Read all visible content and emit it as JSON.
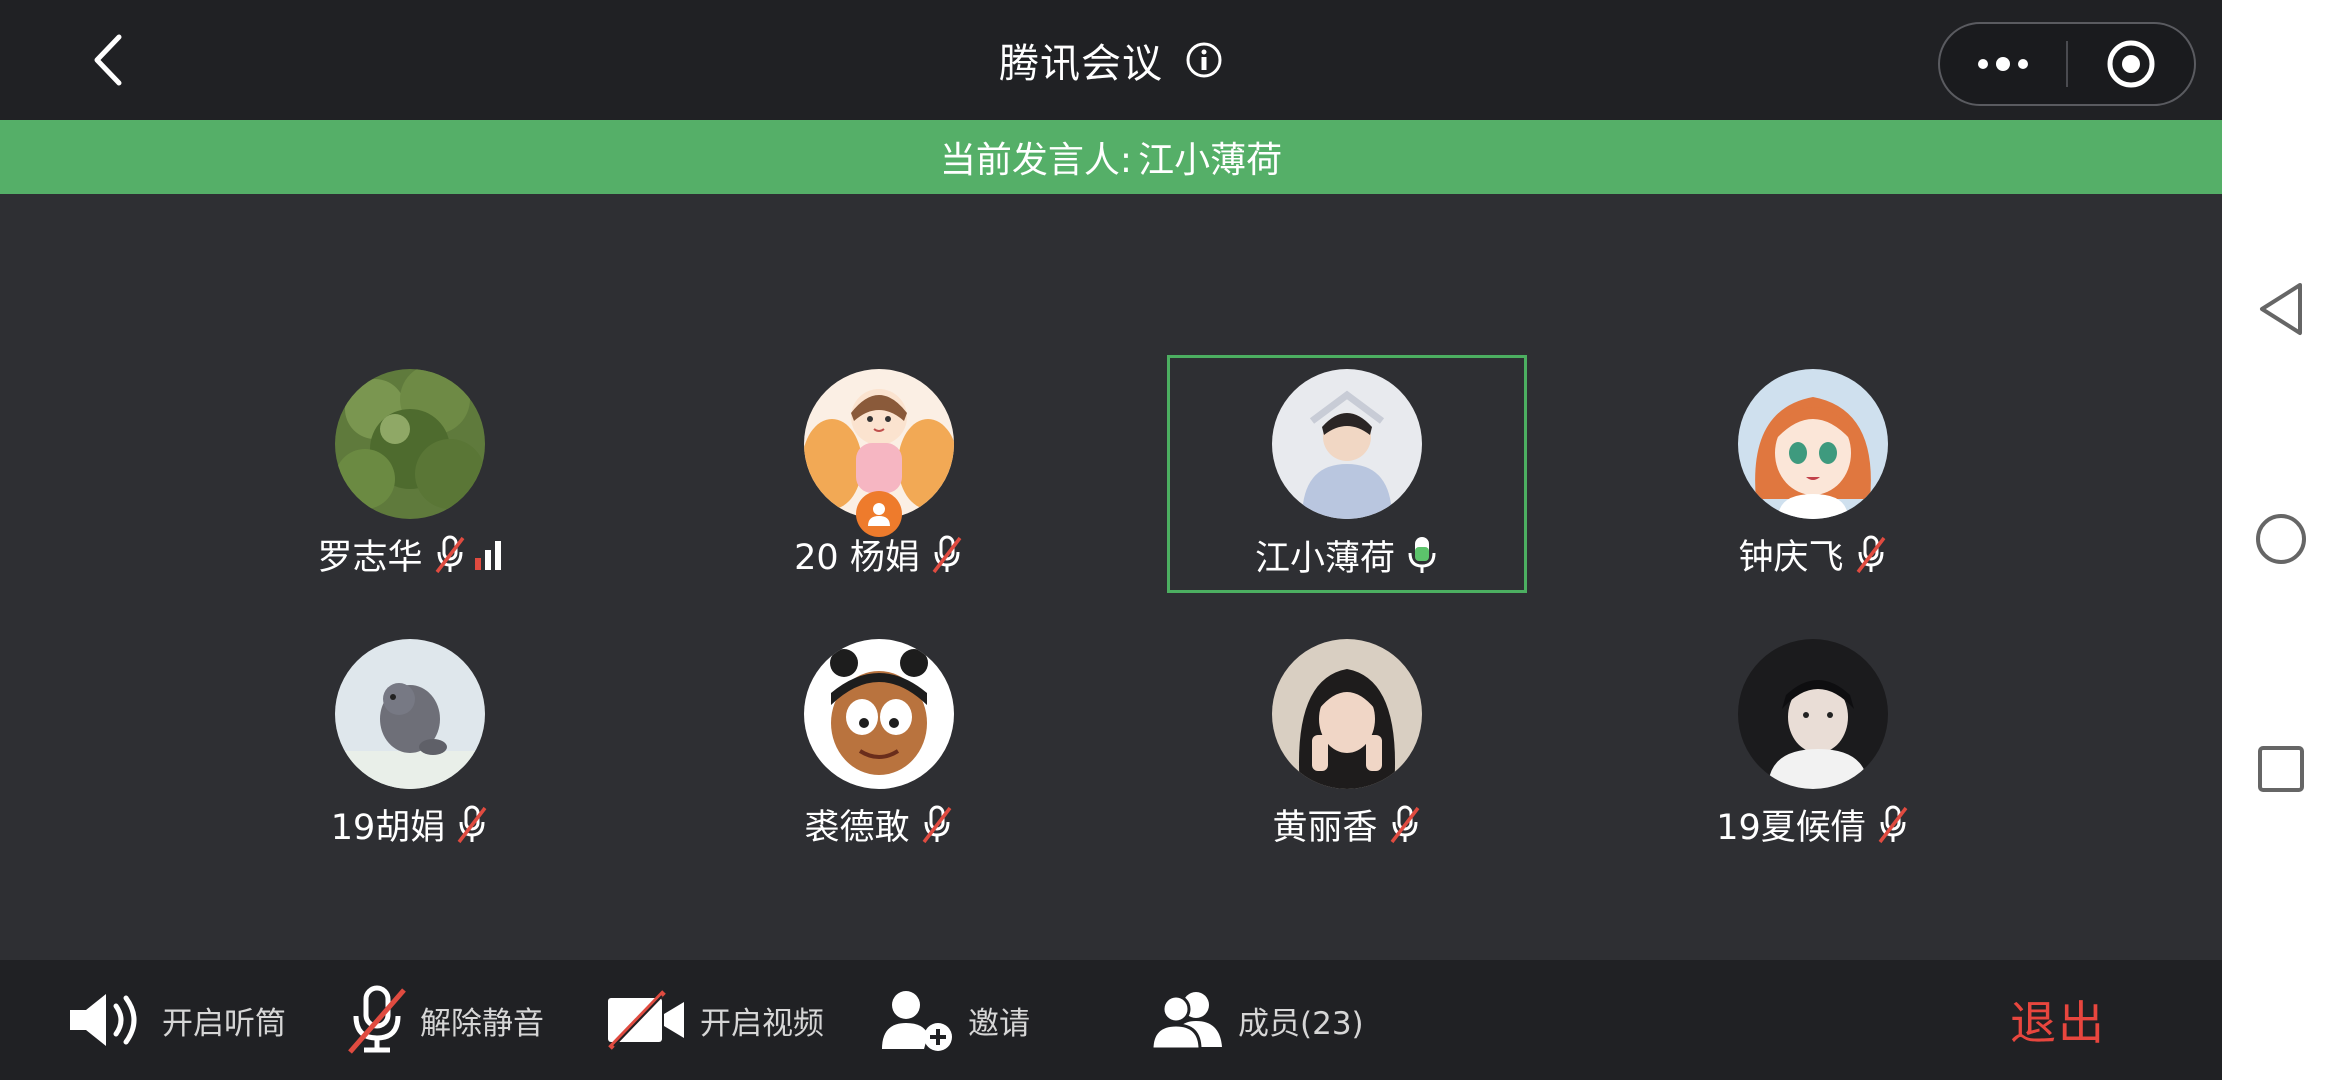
{
  "header": {
    "title": "腾讯会议"
  },
  "speaker": {
    "label": "当前发言人:",
    "name": "江小薄荷"
  },
  "participants": [
    {
      "name": "罗志华",
      "mic": "muted",
      "signal": true
    },
    {
      "name": "20 杨娟",
      "mic": "muted",
      "host": true
    },
    {
      "name": "江小薄荷",
      "mic": "speaking",
      "active": true
    },
    {
      "name": "钟庆飞",
      "mic": "muted"
    },
    {
      "name": "19胡娟",
      "mic": "muted"
    },
    {
      "name": "裘德敢",
      "mic": "muted"
    },
    {
      "name": "黄丽香",
      "mic": "muted"
    },
    {
      "name": "19夏候倩",
      "mic": "muted"
    }
  ],
  "toolbar": {
    "speaker_label": "开启听筒",
    "unmute_label": "解除静音",
    "video_label": "开启视频",
    "invite_label": "邀请",
    "members_label": "成员(23)",
    "exit_label": "退出"
  },
  "colors": {
    "accent_green": "#55af68",
    "exit_red": "#e8463e",
    "host_orange": "#ee7b2c"
  }
}
